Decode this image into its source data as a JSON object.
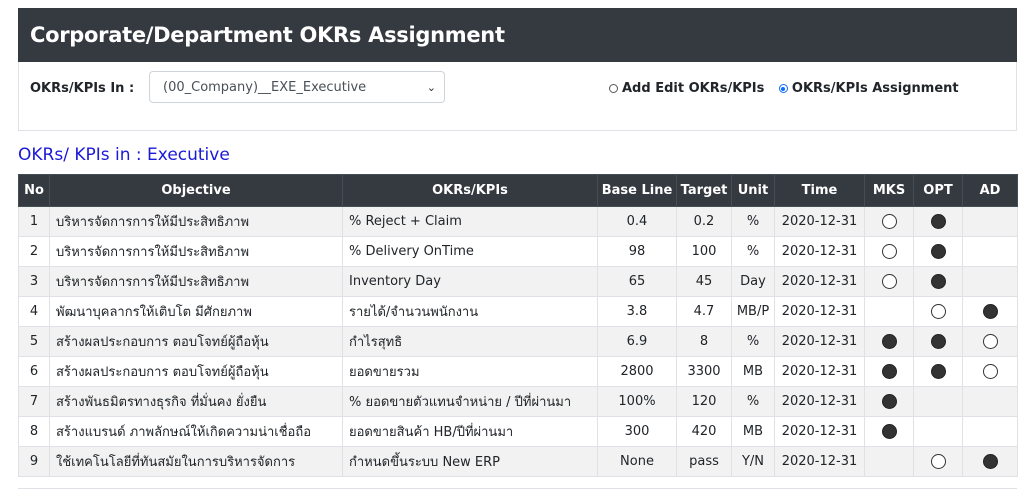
{
  "header": {
    "title": "Corporate/Department OKRs Assignment"
  },
  "filter": {
    "label": "OKRs/KPIs In :",
    "selected": "(00_Company)__EXE_Executive",
    "radio_add_edit": "Add Edit OKRs/KPIs",
    "radio_assignment": "OKRs/KPIs Assignment",
    "selected_mode": "assignment"
  },
  "section_title": "OKRs/ KPIs in : Executive",
  "table": {
    "headers": [
      "No",
      "Objective",
      "OKRs/KPIs",
      "Base Line",
      "Target",
      "Unit",
      "Time",
      "MKS",
      "OPT",
      "AD"
    ],
    "rows": [
      {
        "no": "1",
        "objective": "บริหารจัดการการให้มีประสิทธิภาพ",
        "kpi": "% Reject + Claim",
        "base": "0.4",
        "target": "0.2",
        "unit": "%",
        "time": "2020-12-31",
        "mks": "empty",
        "opt": "filled",
        "ad": ""
      },
      {
        "no": "2",
        "objective": "บริหารจัดการการให้มีประสิทธิภาพ",
        "kpi": "% Delivery OnTime",
        "base": "98",
        "target": "100",
        "unit": "%",
        "time": "2020-12-31",
        "mks": "empty",
        "opt": "filled",
        "ad": ""
      },
      {
        "no": "3",
        "objective": "บริหารจัดการการให้มีประสิทธิภาพ",
        "kpi": "Inventory Day",
        "base": "65",
        "target": "45",
        "unit": "Day",
        "time": "2020-12-31",
        "mks": "empty",
        "opt": "filled",
        "ad": ""
      },
      {
        "no": "4",
        "objective": "พัฒนาบุคลากรให้เติบโต มีศักยภาพ",
        "kpi": "รายได้/จำนวนพนักงาน",
        "base": "3.8",
        "target": "4.7",
        "unit": "MB/P",
        "time": "2020-12-31",
        "mks": "",
        "opt": "empty",
        "ad": "filled"
      },
      {
        "no": "5",
        "objective": "สร้างผลประกอบการ ตอบโจทย์ผู้ถือหุ้น",
        "kpi": "กำไรสุทธิ",
        "base": "6.9",
        "target": "8",
        "unit": "%",
        "time": "2020-12-31",
        "mks": "filled",
        "opt": "filled",
        "ad": "empty"
      },
      {
        "no": "6",
        "objective": "สร้างผลประกอบการ ตอบโจทย์ผู้ถือหุ้น",
        "kpi": "ยอดขายรวม",
        "base": "2800",
        "target": "3300",
        "unit": "MB",
        "time": "2020-12-31",
        "mks": "filled",
        "opt": "filled",
        "ad": "empty"
      },
      {
        "no": "7",
        "objective": "สร้างพันธมิตรทางธุรกิจ ที่มั่นคง ยั่งยืน",
        "kpi": "% ยอดขายตัวแทนจำหน่าย / ปีที่ผ่านมา",
        "base": "100%",
        "target": "120",
        "unit": "%",
        "time": "2020-12-31",
        "mks": "filled",
        "opt": "",
        "ad": ""
      },
      {
        "no": "8",
        "objective": "สร้างแบรนด์ ภาพลักษณ์ให้เกิดความน่าเชื่อถือ",
        "kpi": "ยอดขายสินค้า HB/ปีที่ผ่านมา",
        "base": "300",
        "target": "420",
        "unit": "MB",
        "time": "2020-12-31",
        "mks": "filled",
        "opt": "",
        "ad": ""
      },
      {
        "no": "9",
        "objective": "ใช้เทคโนโลยีที่ทันสมัยในการบริหารจัดการ",
        "kpi": "กำหนดขึ้นระบบ New ERP",
        "base": "None",
        "target": "pass",
        "unit": "Y/N",
        "time": "2020-12-31",
        "mks": "",
        "opt": "empty",
        "ad": "filled"
      }
    ]
  },
  "colors": {
    "header_bg": "#343a40",
    "section_title": "#1a19d8",
    "radio_accent": "#0d6efd"
  }
}
